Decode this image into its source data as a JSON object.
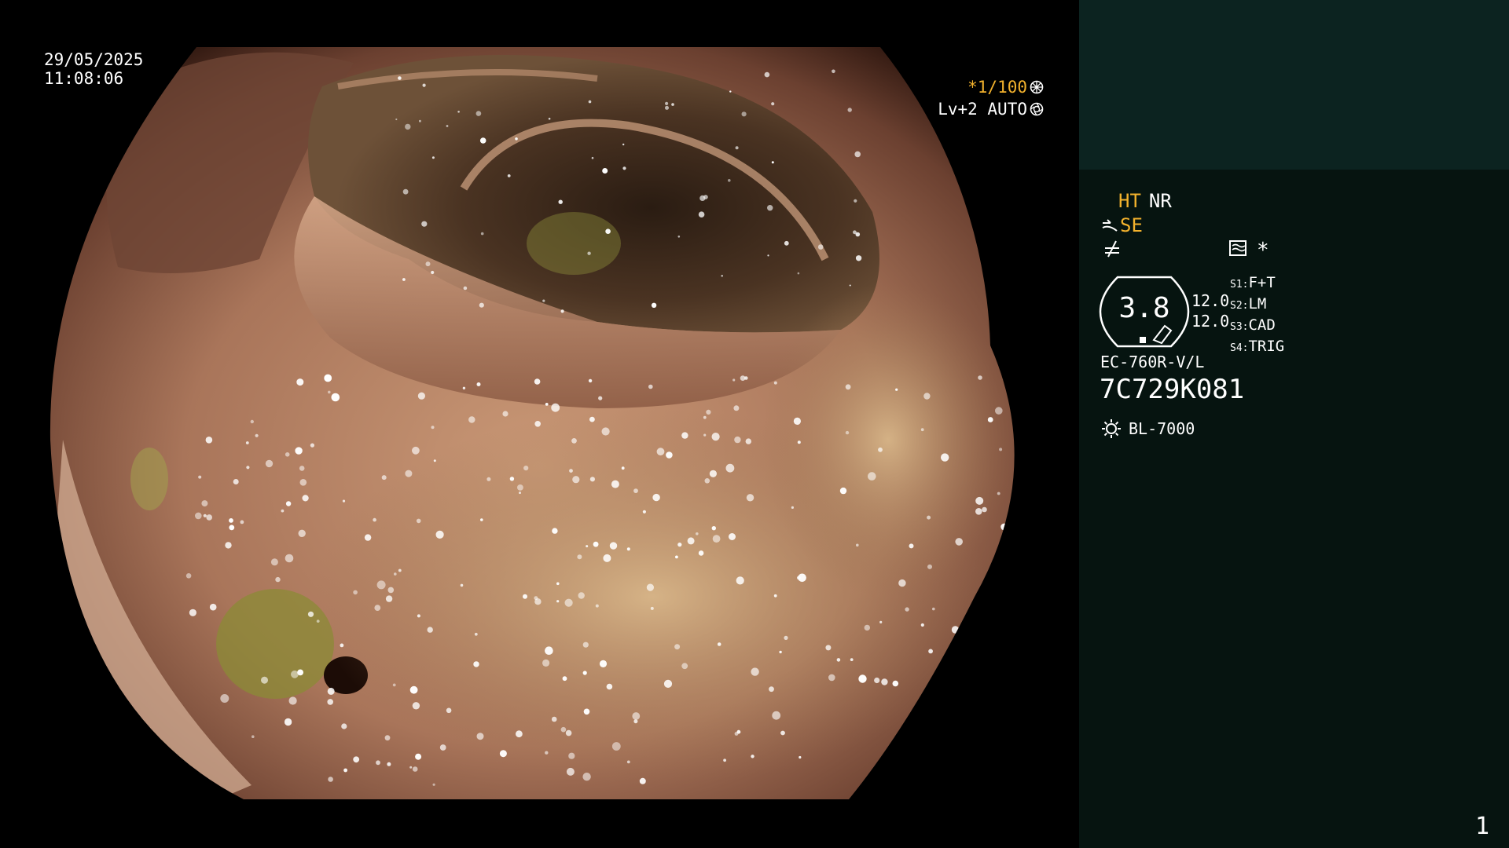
{
  "image": {
    "kind": "endoscopy-frame",
    "subject": "colonic-lumen"
  },
  "overlay": {
    "date": "29/05/2025",
    "time": "11:08:06",
    "shutter": "*1/100",
    "level": "Lv+2 AUTO"
  },
  "panel": {
    "ht": "HT",
    "nr": "NR",
    "se": "SE",
    "star": "*",
    "gauge_value": "3.8",
    "gain_1": "12.0",
    "gain_2": "12.0",
    "switches": [
      {
        "key": "S1:",
        "value": "F+T"
      },
      {
        "key": "S2:",
        "value": "LM"
      },
      {
        "key": "S3:",
        "value": "CAD"
      },
      {
        "key": "S4:",
        "value": "TRIG"
      }
    ],
    "scope_model": "EC-760R-V/L",
    "scope_serial": "7C729K081",
    "light_source": "BL-7000",
    "page_number": "1"
  },
  "colors": {
    "accent_yellow": "#f3b22d",
    "panel_bg": "#061410",
    "panel_top_bg": "#0c2320",
    "mucosa": "#b07a5a"
  },
  "icons": [
    "gear-icon",
    "aperture-icon",
    "scope-tip-icon",
    "ne-icon",
    "filter-icon",
    "light-source-icon"
  ]
}
